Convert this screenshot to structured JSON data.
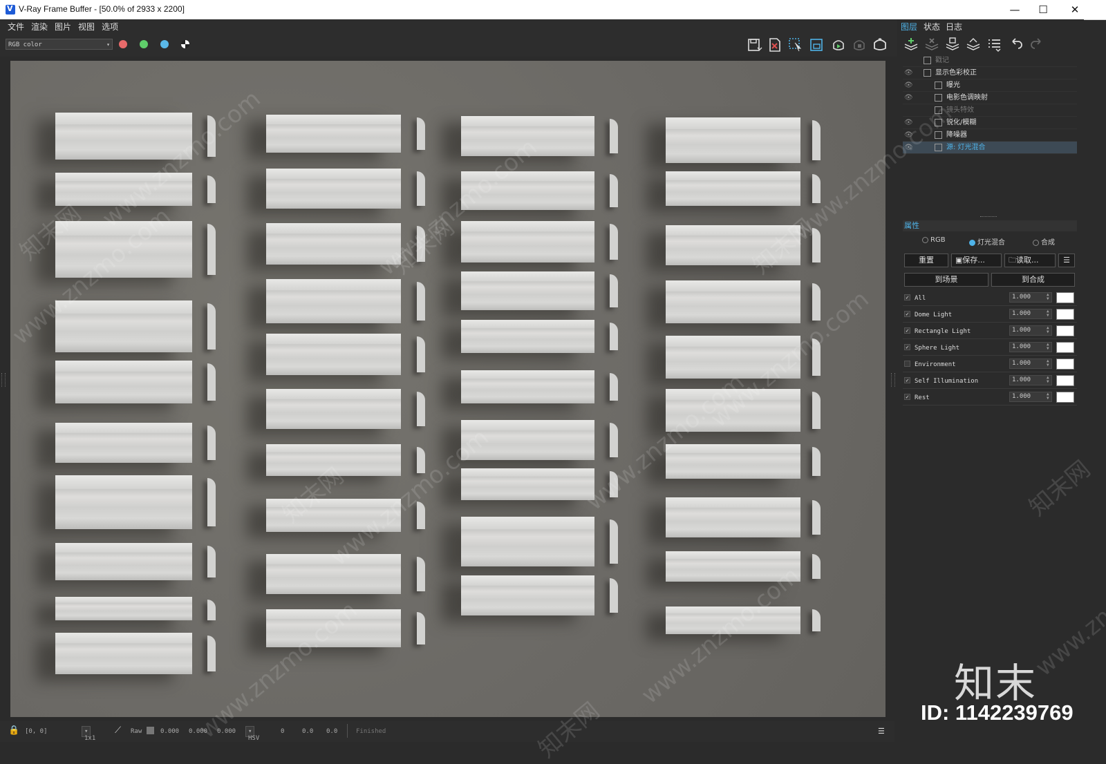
{
  "window": {
    "title": "V-Ray Frame Buffer - [50.0% of 2933 x 2200]",
    "minimize": "—",
    "maximize": "☐",
    "close": "✕"
  },
  "menu": [
    "文件",
    "渲染",
    "图片",
    "视图",
    "选项"
  ],
  "toolbar": {
    "channel": "RGB color",
    "colors": {
      "red": "#e86a6a",
      "green": "#5fce6a",
      "blue": "#5ab8e8"
    },
    "icons": [
      "save-image-icon",
      "clear-image-icon",
      "track-mouse-icon",
      "region-render-icon",
      "render-icon",
      "stop-render-icon",
      "interactive-render-icon"
    ]
  },
  "panel": {
    "tabs": [
      "图层",
      "状态",
      "日志"
    ],
    "layers": [
      {
        "name": "戳记",
        "visible": false,
        "dim": true
      },
      {
        "name": "显示色彩校正",
        "visible": true,
        "dim": false
      },
      {
        "name": "曝光",
        "visible": true,
        "dim": false
      },
      {
        "name": "电影色调映射",
        "visible": true,
        "dim": false
      },
      {
        "name": "镜头特效",
        "visible": false,
        "dim": true
      },
      {
        "name": "锐化/模糊",
        "visible": true,
        "dim": false
      },
      {
        "name": "降噪器",
        "visible": true,
        "dim": false
      },
      {
        "name": "源: 灯光混合",
        "visible": true,
        "dim": false,
        "selected": true
      }
    ],
    "properties_title": "属性",
    "modes": {
      "rgb": "RGB",
      "lightmix": "灯光混合",
      "composite": "合成",
      "selected": "lightmix"
    },
    "buttons": {
      "reset": "重置",
      "save": "保存...",
      "load": "读取...",
      "to_scene": "到场景",
      "to_composite": "到合成"
    },
    "lightmix": [
      {
        "name": "All",
        "checked": true,
        "value": "1.000"
      },
      {
        "name": "Dome Light",
        "checked": true,
        "value": "1.000"
      },
      {
        "name": "Rectangle Light",
        "checked": true,
        "value": "1.000"
      },
      {
        "name": "Sphere Light",
        "checked": true,
        "value": "1.000"
      },
      {
        "name": "Environment",
        "checked": false,
        "value": "1.000"
      },
      {
        "name": "Self Illumination",
        "checked": true,
        "value": "1.000"
      },
      {
        "name": "Rest",
        "checked": true,
        "value": "1.000"
      }
    ]
  },
  "status": {
    "coords": "[0, 0]",
    "zoom": "1x1",
    "raw": "Raw",
    "r": "0.000",
    "g": "0.000",
    "b": "0.000",
    "colorspace": "HSV",
    "h": "0",
    "s": "0.0",
    "v": "0.0",
    "state": "Finished"
  },
  "watermark": {
    "site": "www.znzmo.com",
    "brand": "知末网",
    "logo": "知末",
    "id": "ID: 1142239769"
  }
}
